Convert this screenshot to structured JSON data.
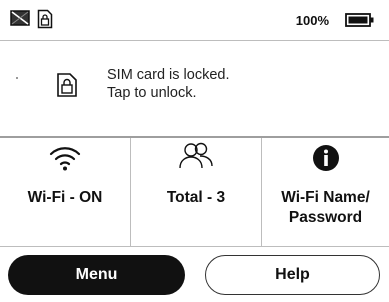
{
  "status_bar": {
    "icons": [
      "message-icon",
      "sim-lock-icon",
      "battery-icon"
    ],
    "battery_percent": "100%"
  },
  "notice": {
    "icon": "sim-lock-icon",
    "line1": "SIM card is locked.",
    "line2": "Tap to unlock."
  },
  "tiles": [
    {
      "icon": "wifi-icon",
      "label": "Wi-Fi - ON"
    },
    {
      "icon": "users-icon",
      "label": "Total - 3"
    },
    {
      "icon": "info-icon",
      "label_line1": "Wi-Fi Name/",
      "label_line2": "Password"
    }
  ],
  "buttons": {
    "menu": "Menu",
    "help": "Help"
  }
}
